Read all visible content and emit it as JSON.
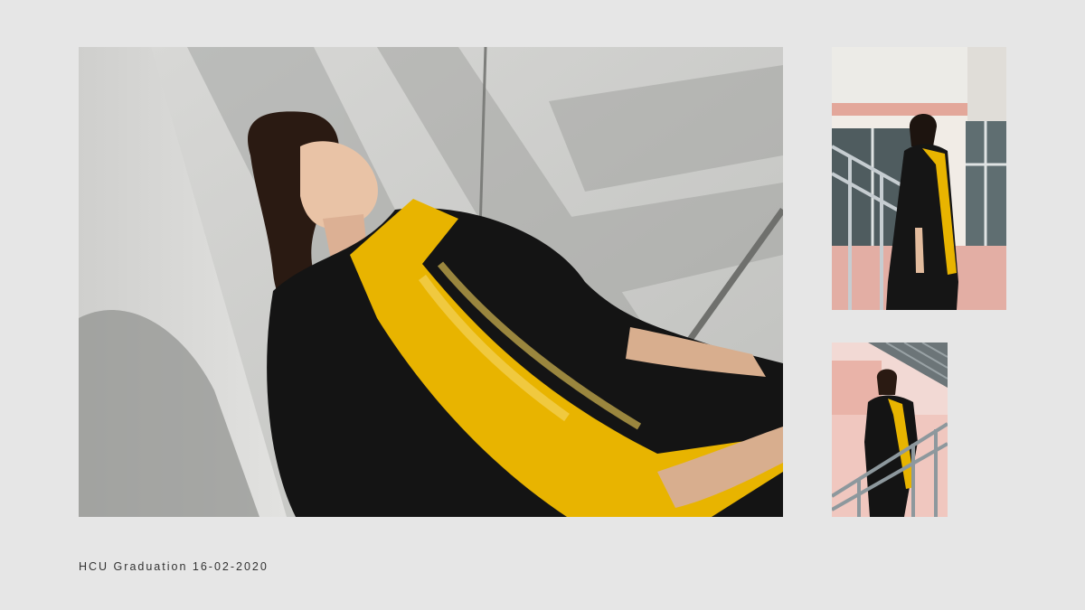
{
  "caption": "HCU Graduation 16-02-2020",
  "photos": [
    {
      "subject": "graduate-sitting-photo"
    },
    {
      "subject": "graduate-standing-stairs-photo"
    },
    {
      "subject": "graduate-railing-photo"
    }
  ],
  "colors": {
    "background": "#e6e6e6",
    "gown": "#141414",
    "hood": "#e8b400",
    "caption": "#333333"
  }
}
